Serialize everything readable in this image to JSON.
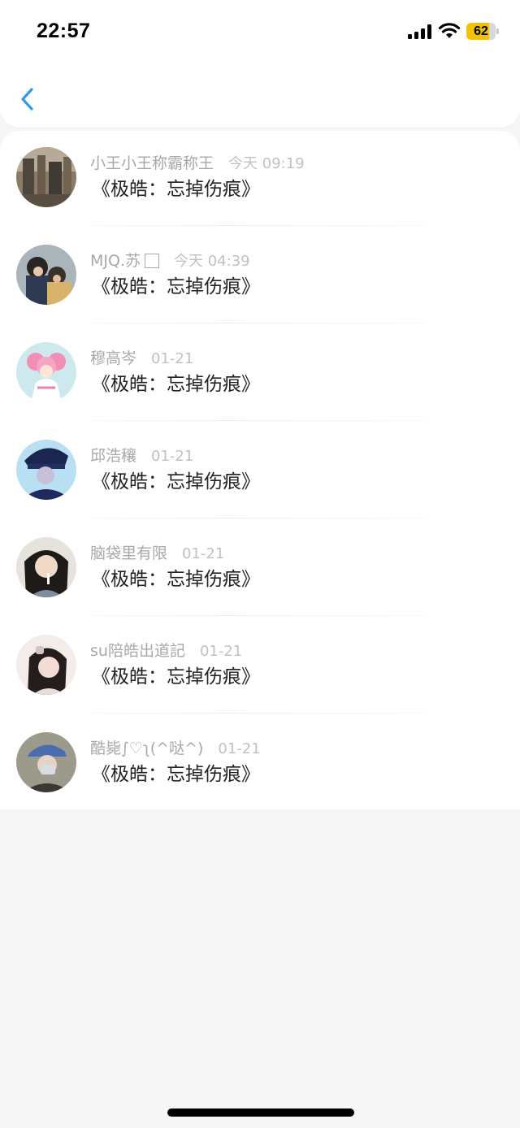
{
  "status_bar": {
    "time": "22:57",
    "battery": "62",
    "battery_color": "#f2c200"
  },
  "nav": {
    "back_icon": "chevron-left-icon",
    "accent_color": "#2f9bea"
  },
  "items": [
    {
      "name": "小王小王称霸称王",
      "time": "今天 09:19",
      "title": "《极皓：忘掉伤痕》"
    },
    {
      "name": "MJQ.苏",
      "time": "今天 04:39",
      "title": "《极皓：忘掉伤痕》"
    },
    {
      "name": "穆高岑",
      "time": "01-21",
      "title": "《极皓：忘掉伤痕》"
    },
    {
      "name": "邱浩穰",
      "time": "01-21",
      "title": "《极皓：忘掉伤痕》"
    },
    {
      "name": "脑袋里有限",
      "time": "01-21",
      "title": "《极皓：忘掉伤痕》"
    },
    {
      "name": "su陪皓出道記",
      "time": "01-21",
      "title": "《极皓：忘掉伤痕》"
    },
    {
      "name": "酷毙∫♡ʅ(^哒^)",
      "time": "01-21",
      "title": "《极皓：忘掉伤痕》"
    }
  ]
}
